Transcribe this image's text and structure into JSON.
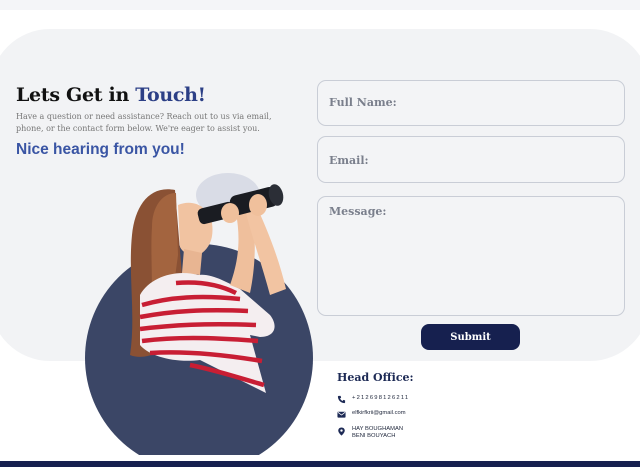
{
  "contact": {
    "heading_prefix": "Lets Get in ",
    "heading_accent": "Touch!",
    "intro_line1": "Have a question or need assistance? Reach out to us via email,",
    "intro_line2": "phone, or the contact form below. We're eager to assist you.",
    "tagline": "Nice hearing from you!"
  },
  "form": {
    "full_name_label": "Full Name:",
    "email_label": "Email:",
    "message_label": "Message:",
    "submit_label": "Submit"
  },
  "office": {
    "title": "Head Office:",
    "phone": "+212698126211",
    "email": "elfkirfkrii@gmail.com",
    "address_line1": "HAY BOUGHAMAN",
    "address_line2": "BENI BOUYACH"
  },
  "icons": {
    "phone": "phone-icon",
    "email": "envelope-icon",
    "location": "map-pin-icon"
  },
  "colors": {
    "accent": "#2c3f86",
    "tagline": "#3a55a4",
    "navy": "#16204f",
    "circle": "#3b4666",
    "card": "#f2f3f5"
  }
}
